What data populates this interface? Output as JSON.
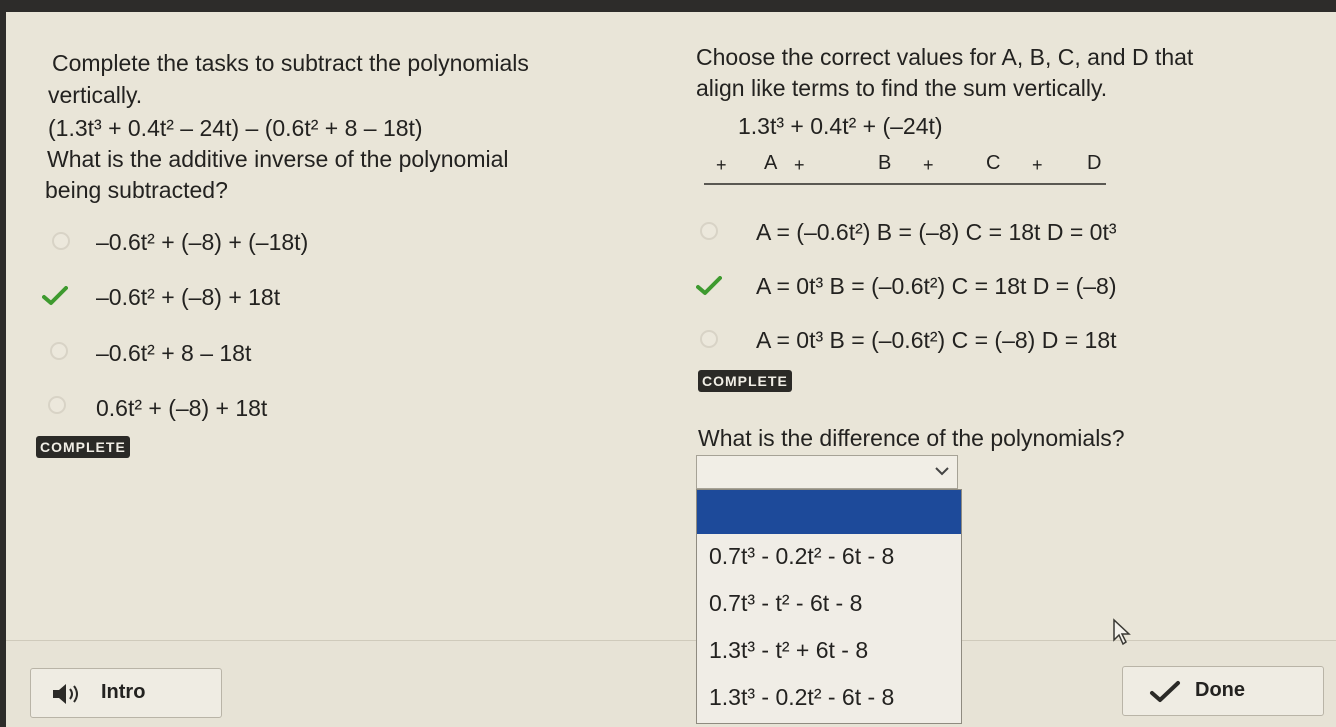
{
  "left": {
    "prompt_line1": "Complete the tasks to subtract the polynomials",
    "prompt_line2": "vertically.",
    "expression": "(1.3t³ + 0.4t² – 24t) – (0.6t² + 8 – 18t)",
    "question_line1": "What is the additive inverse of the polynomial",
    "question_line2": "being subtracted?",
    "options": [
      "–0.6t² + (–8) + (–18t)",
      "–0.6t² + (–8) + 18t",
      "–0.6t² + 8 – 18t",
      "0.6t² + (–8) + 18t"
    ],
    "status": "COMPLETE"
  },
  "right": {
    "prompt_line1": "Choose the correct values for A, B, C, and D that",
    "prompt_line2": "align like terms to find the sum vertically.",
    "top_row": "1.3t³ + 0.4t² + (–24t)",
    "plus_sign": "+",
    "letters": [
      "A",
      "B",
      "C",
      "D"
    ],
    "options": [
      "A = (–0.6t²)  B =      (–8)  C = 18t  D = 0t³",
      "A = 0t³  B = (–0.6t²)  C = 18t  D = (–8)",
      "A = 0t³  B = (–0.6t²)  C = (–8)  D = 18t"
    ],
    "status": "COMPLETE",
    "question": "What is the difference of the polynomials?",
    "dropdown_options": [
      "0.7t³ - 0.2t² - 6t - 8",
      "0.7t³ - t² - 6t - 8",
      "1.3t³ - t² + 6t - 8",
      "1.3t³ - 0.2t² - 6t - 8"
    ]
  },
  "footer": {
    "intro_label": "Intro",
    "done_label": "Done"
  },
  "icons": {
    "checkmark": "checkmark-icon",
    "speaker": "speaker-icon",
    "chevron": "chevron-down-icon",
    "cursor": "mouse-cursor-icon"
  },
  "colors": {
    "check": "#3e9a2f",
    "selection": "#1d4a9a",
    "badge": "#2b2a27"
  }
}
